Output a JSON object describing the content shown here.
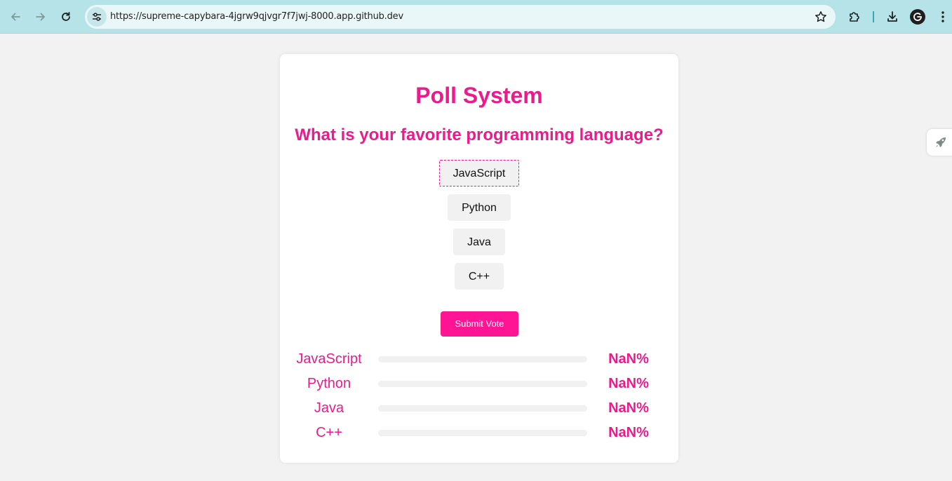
{
  "browser": {
    "url": "https://supreme-capybara-4jgrw9qjvgr7f7jwj-8000.app.github.dev",
    "icons": {
      "back": "arrow-left-icon",
      "forward": "arrow-right-icon",
      "reload": "reload-icon",
      "site_info": "tune-icon",
      "bookmark": "star-icon",
      "extensions": "puzzle-icon",
      "downloads": "download-icon",
      "profile": "avatar",
      "menu": "kebab-menu-icon"
    },
    "colors": {
      "toolbar": "#b5e3e8",
      "omnibox": "#eaf7f8"
    }
  },
  "side_tab": {
    "icon": "rocket-icon"
  },
  "poll": {
    "title": "Poll System",
    "question": "What is your favorite programming language?",
    "options": [
      {
        "label": "JavaScript",
        "selected": true
      },
      {
        "label": "Python",
        "selected": false
      },
      {
        "label": "Java",
        "selected": false
      },
      {
        "label": "C++",
        "selected": false
      }
    ],
    "submit_label": "Submit Vote",
    "results": [
      {
        "label": "JavaScript",
        "percent_text": "NaN%",
        "fill_fraction": 0
      },
      {
        "label": "Python",
        "percent_text": "NaN%",
        "fill_fraction": 0
      },
      {
        "label": "Java",
        "percent_text": "NaN%",
        "fill_fraction": 0
      },
      {
        "label": "C++",
        "percent_text": "NaN%",
        "fill_fraction": 0
      }
    ],
    "colors": {
      "accent": "#ec1a8c",
      "button": "#ff1493",
      "option_bg": "#f1f1f1",
      "page_bg": "#f2f2f2"
    }
  }
}
